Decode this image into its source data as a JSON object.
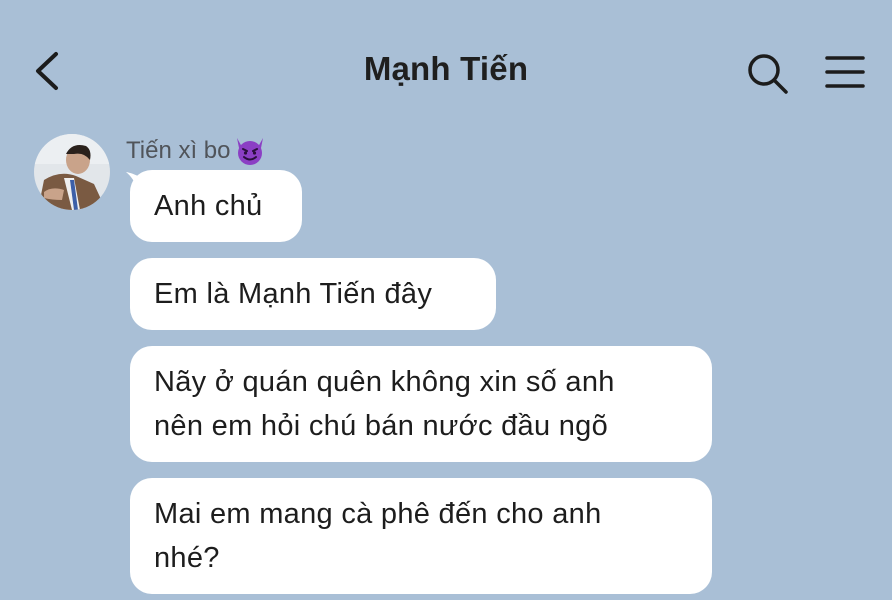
{
  "header": {
    "title": "Mạnh Tiến"
  },
  "icons": {
    "back": "chevron-left-icon",
    "search": "search-icon",
    "menu": "hamburger-menu-icon",
    "sender_emoji": "smiling-devil-icon"
  },
  "chat": {
    "sender_name": "Tiến xì bo",
    "messages": [
      {
        "text": "Anh chủ"
      },
      {
        "text": "Em là Mạnh Tiến đây"
      },
      {
        "text": "Nãy ở quán quên không xin số anh\nnên em hỏi chú bán nước đầu ngõ"
      },
      {
        "text": "Mai em mang cà phê đến cho anh\nnhé?"
      }
    ]
  },
  "colors": {
    "background": "#a9bfd6",
    "bubble": "#ffffff",
    "emoji": "#8b3fc4"
  }
}
